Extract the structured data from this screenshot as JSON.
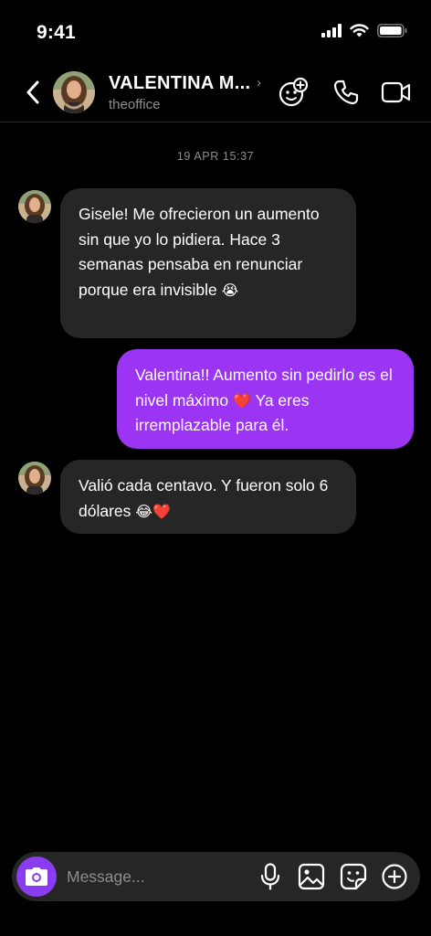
{
  "status": {
    "time": "9:41"
  },
  "header": {
    "name": "VALENTINA M...",
    "username": "theoffice"
  },
  "conversation": {
    "timestamp": "19 APR 15:37",
    "messages": [
      {
        "from": "them",
        "text": "Gisele! Me ofrecieron un aumento sin que yo lo pidiera. Hace 3 semanas pensaba en renunciar porque era invisible",
        "emoji": "😭"
      },
      {
        "from": "me",
        "text": "Valentina!! Aumento sin pedirlo es el nivel máximo",
        "emoji": "❤️",
        "text_after": "Ya eres irremplazable para él."
      },
      {
        "from": "them",
        "text": "Valió cada centavo. Y fueron solo 6 dólares",
        "emoji": "😂❤️"
      }
    ]
  },
  "composer": {
    "placeholder": "Message..."
  },
  "icons": {
    "back": "chevron-left-icon",
    "effects": "face-add-icon",
    "call": "phone-icon",
    "video": "video-icon",
    "camera": "camera-icon",
    "mic": "mic-icon",
    "gallery": "image-icon",
    "sticker": "sticker-icon",
    "more": "plus-circle-icon"
  },
  "colors": {
    "outgoing_bubble": "#9b34f3",
    "incoming_bubble": "#262626",
    "camera_button": "#8a3df0"
  }
}
